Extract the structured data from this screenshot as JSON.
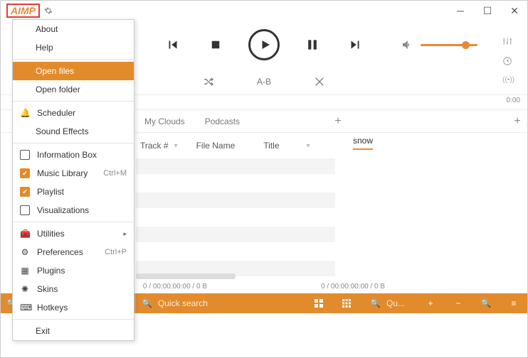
{
  "app": {
    "logo": "AIMP"
  },
  "menu": {
    "about": "About",
    "help": "Help",
    "open_files": "Open files",
    "open_folder": "Open folder",
    "scheduler": "Scheduler",
    "sound_effects": "Sound Effects",
    "info_box": "Information Box",
    "music_library": "Music Library",
    "music_library_sc": "Ctrl+M",
    "playlist": "Playlist",
    "visualizations": "Visualizations",
    "utilities": "Utilities",
    "preferences": "Preferences",
    "preferences_sc": "Ctrl+P",
    "plugins": "Plugins",
    "skins": "Skins",
    "hotkeys": "Hotkeys",
    "exit": "Exit"
  },
  "modes": {
    "ab": "A-B"
  },
  "time": {
    "end": "0:00"
  },
  "tabs": {
    "left": [
      "My Clouds",
      "Podcasts"
    ],
    "right_active": "snow"
  },
  "columns": {
    "track": "Track #",
    "filename": "File Name",
    "title": "Title"
  },
  "status": {
    "left": "0 / 00:00:00:00 / 0 B",
    "right": "0 / 00:00:00:00 / 0 B"
  },
  "search": {
    "placeholder1": "Quick search",
    "placeholder2": "Quick search",
    "placeholder3": "Qu..."
  }
}
